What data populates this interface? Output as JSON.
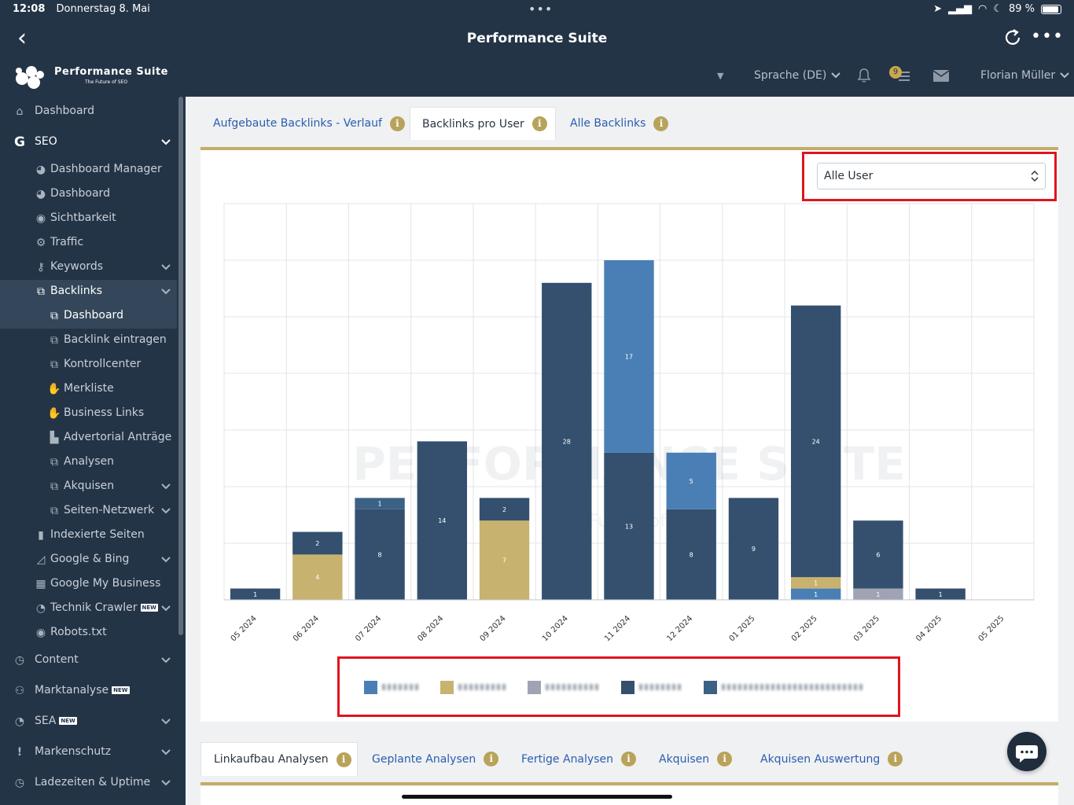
{
  "status_bar": {
    "time": "12:08",
    "date": "Donnerstag 8. Mai",
    "battery": "89 %"
  },
  "app": {
    "title": "Performance Suite"
  },
  "brand": {
    "name": "Performance Suite",
    "tagline": "The Future of SEO"
  },
  "header": {
    "language": "Sprache (DE)",
    "notification_count": "9",
    "user": "Florian Müller"
  },
  "sidebar": {
    "items": [
      {
        "label": "Dashboard",
        "icon": "home-icon"
      },
      {
        "label": "SEO",
        "icon": "google-g-icon"
      },
      {
        "label": "Dashboard Manager",
        "icon": "dashboard-icon"
      },
      {
        "label": "Dashboard",
        "icon": "dashboard-icon"
      },
      {
        "label": "Sichtbarkeit",
        "icon": "eye-icon"
      },
      {
        "label": "Traffic",
        "icon": "cogs-icon"
      },
      {
        "label": "Keywords",
        "icon": "key-icon"
      },
      {
        "label": "Backlinks",
        "icon": "external-link-icon"
      },
      {
        "label": "Dashboard",
        "icon": "external-link-icon"
      },
      {
        "label": "Backlink eintragen",
        "icon": "external-link-icon"
      },
      {
        "label": "Kontrollcenter",
        "icon": "external-link-icon"
      },
      {
        "label": "Merkliste",
        "icon": "handshake-icon"
      },
      {
        "label": "Business Links",
        "icon": "handshake-icon"
      },
      {
        "label": "Advertorial Anträge",
        "icon": "cart-icon"
      },
      {
        "label": "Analysen",
        "icon": "external-link-icon"
      },
      {
        "label": "Akquisen",
        "icon": "external-link-icon"
      },
      {
        "label": "Seiten-Netzwerk",
        "icon": "external-link-icon"
      },
      {
        "label": "Indexierte Seiten",
        "icon": "file-icon"
      },
      {
        "label": "Google & Bing",
        "icon": "area-chart-icon"
      },
      {
        "label": "Google My Business",
        "icon": "store-icon"
      },
      {
        "label": "Technik Crawler",
        "icon": "pie-chart-icon"
      },
      {
        "label": "Robots.txt",
        "icon": "eye-icon"
      },
      {
        "label": "Content",
        "icon": "clock-icon"
      },
      {
        "label": "Marktanalyse",
        "icon": "users-icon"
      },
      {
        "label": "SEA",
        "icon": "pie-chart-icon"
      },
      {
        "label": "Markenschutz",
        "icon": "exclamation-icon"
      },
      {
        "label": "Ladezeiten & Uptime",
        "icon": "clock-icon"
      }
    ],
    "new_badge": "NEW"
  },
  "tabs_top": [
    {
      "label": "Aufgebaute Backlinks - Verlauf"
    },
    {
      "label": "Backlinks pro User"
    },
    {
      "label": "Alle Backlinks"
    }
  ],
  "user_select": {
    "value": "Alle User"
  },
  "chart_watermark": {
    "name": "Performance Suite",
    "tagline": "The Future of SEO"
  },
  "chart_data": {
    "type": "bar",
    "stacked": true,
    "categories": [
      "05 2024",
      "06 2024",
      "07 2024",
      "08 2024",
      "09 2024",
      "10 2024",
      "11 2024",
      "12 2024",
      "01 2025",
      "02 2025",
      "03 2025",
      "04 2025",
      "05 2025"
    ],
    "ylim": [
      0,
      35
    ],
    "grid": true,
    "legend_position": "bottom",
    "series": [
      {
        "color": "#4a7fb5",
        "values": [
          0,
          0,
          0,
          0,
          0,
          0,
          17,
          5,
          0,
          1,
          0,
          0,
          0
        ]
      },
      {
        "color": "#c8b26f",
        "values": [
          0,
          4,
          0,
          0,
          7,
          0,
          0,
          0,
          0,
          1,
          0,
          0,
          0
        ]
      },
      {
        "color": "#9fa3b3",
        "values": [
          0,
          0,
          0,
          0,
          0,
          0,
          0,
          0,
          0,
          0,
          1,
          0,
          0
        ]
      },
      {
        "color": "#34506e",
        "values": [
          1,
          2,
          8,
          14,
          2,
          28,
          13,
          8,
          9,
          24,
          6,
          1,
          0
        ]
      },
      {
        "color": "#3b6185",
        "values": [
          0,
          0,
          1,
          0,
          0,
          0,
          0,
          0,
          0,
          0,
          0,
          0,
          0
        ]
      }
    ]
  },
  "tabs_bottom": [
    {
      "label": "Linkaufbau Analysen"
    },
    {
      "label": "Geplante Analysen"
    },
    {
      "label": "Fertige Analysen"
    },
    {
      "label": "Akquisen"
    },
    {
      "label": "Akquisen Auswertung"
    }
  ],
  "info_glyph": "i"
}
